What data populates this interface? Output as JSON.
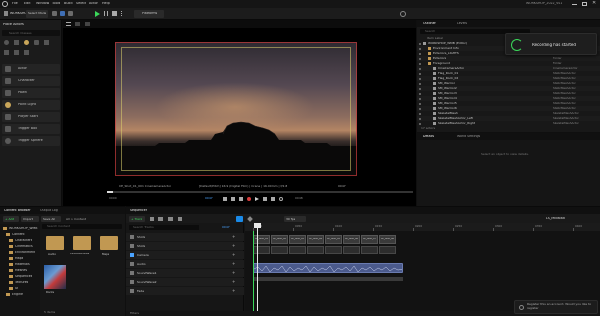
{
  "titlebar": {
    "project": "WORKSHOP_WMB",
    "menu": [
      "File",
      "Edit",
      "Window",
      "Tools",
      "Build",
      "Select",
      "Actor",
      "Help"
    ],
    "right_info": "WORKSHOP_2022_VS1"
  },
  "toolbar": {
    "select_mode": "Select Mode",
    "platforms": "Platforms"
  },
  "place_actors": {
    "title": "Place Actors",
    "search_placeholder": "Search Classes",
    "items": [
      "Actor",
      "Character",
      "Pawn",
      "Point Light",
      "Player Start",
      "Trigger Box",
      "Trigger Sphere"
    ]
  },
  "viewport": {
    "hud_left": "CE_Shot_01_001 CineCameraActor",
    "hud_mid": "[Default/Pitch] 16:9 (Digital Film) | Crane | 16.00mm | f/2.8",
    "hud_right": "0047",
    "timeline_left": "0000",
    "timeline_mid": "0047",
    "timeline_right": "0048"
  },
  "outliner": {
    "tabs": [
      "Outliner",
      "Levels"
    ],
    "search_placeholder": "Search",
    "col_label": "Item Label",
    "col_type": "Type",
    "items": [
      {
        "label": "WORKSHOP_WMB (Editor)",
        "type": "World",
        "indent": 0
      },
      {
        "label": "Environment Info",
        "type": "Folder",
        "indent": 1
      },
      {
        "label": "Exteriors_LIGHTS",
        "type": "Folder",
        "indent": 1
      },
      {
        "label": "Exteriors",
        "type": "Folder",
        "indent": 1
      },
      {
        "label": "Foreground",
        "type": "Folder",
        "indent": 1
      },
      {
        "label": "CineCameraActor",
        "type": "CineCameraActor",
        "indent": 2
      },
      {
        "label": "Flag_Rock_01",
        "type": "StaticMeshActor",
        "indent": 2
      },
      {
        "label": "Flag_Rock_02",
        "type": "StaticMeshActor",
        "indent": 2
      },
      {
        "label": "SM_Warrior",
        "type": "StaticMeshActor",
        "indent": 2
      },
      {
        "label": "SM_Warrior2",
        "type": "StaticMeshActor",
        "indent": 2
      },
      {
        "label": "SM_Warrior3",
        "type": "StaticMeshActor",
        "indent": 2
      },
      {
        "label": "SM_Warrior4",
        "type": "StaticMeshActor",
        "indent": 2
      },
      {
        "label": "SM_Warrior5",
        "type": "StaticMeshActor",
        "indent": 2
      },
      {
        "label": "SM_Warrior6",
        "type": "StaticMeshActor",
        "indent": 2
      },
      {
        "label": "SkeletalMesh",
        "type": "SkeletalMeshActor",
        "indent": 2
      },
      {
        "label": "SkeletalMeshActor_Left",
        "type": "SkeletalMeshActor",
        "indent": 2
      },
      {
        "label": "SkeletalMeshActor_Right",
        "type": "SkeletalMeshActor",
        "indent": 2
      }
    ],
    "footer": "17 actors"
  },
  "details": {
    "tabs": [
      "Details",
      "World Settings"
    ],
    "empty_text": "Select an object to view details."
  },
  "toast": {
    "text": "Recording has started"
  },
  "content_browser": {
    "tabs": [
      "Content Browser",
      "Output Log"
    ],
    "add_label": "+ Add",
    "import_label": "Import",
    "save_all_label": "Save All",
    "breadcrumb": "All > Content",
    "search_placeholder": "Search Content",
    "tree": [
      "WORKSHOP_WMB",
      "Content",
      "Characters",
      "Cinematics",
      "Environment",
      "Maps",
      "Materials",
      "Meshes",
      "Sequences",
      "Textures",
      "UI",
      "Engine"
    ],
    "assets": [
      "Audio",
      "CinematicMats",
      "Maps",
      "Rocks",
      "Sequence01"
    ],
    "footer": "5 items"
  },
  "sequencer": {
    "tab": "Sequencer",
    "track_btn": "+ Track",
    "filter_placeholder": "Search Tracks",
    "fps": "30 fps",
    "sequence_name": "LS_Mkxstad",
    "tracks": [
      "Shots",
      "Shots",
      "Camera",
      "Audio",
      "SoundWave1",
      "SoundWave2",
      "Fade"
    ],
    "time_start": "0000",
    "time_end": "0450",
    "playhead": "0047",
    "ruler_labels": [
      "0000",
      "0050",
      "0100",
      "0150",
      "0200",
      "0250",
      "0300",
      "0350",
      "0400"
    ],
    "clips": [
      "CE_Shot_01",
      "CE_Shot_02",
      "CE_Shot_03",
      "CE_Shot_04",
      "CE_Shot_05",
      "CE_Shot_06",
      "CE_Shot_07",
      "CE_Shot_08"
    ],
    "footer": "Filters"
  },
  "notification": {
    "text": "Register this an account. Would you like to register"
  },
  "colors": {
    "accent": "#1a8ae8",
    "record_green": "#3bd85a",
    "playhead": "#e8e8e8",
    "audio": "#5a6aa0",
    "folder": "#c19852"
  }
}
